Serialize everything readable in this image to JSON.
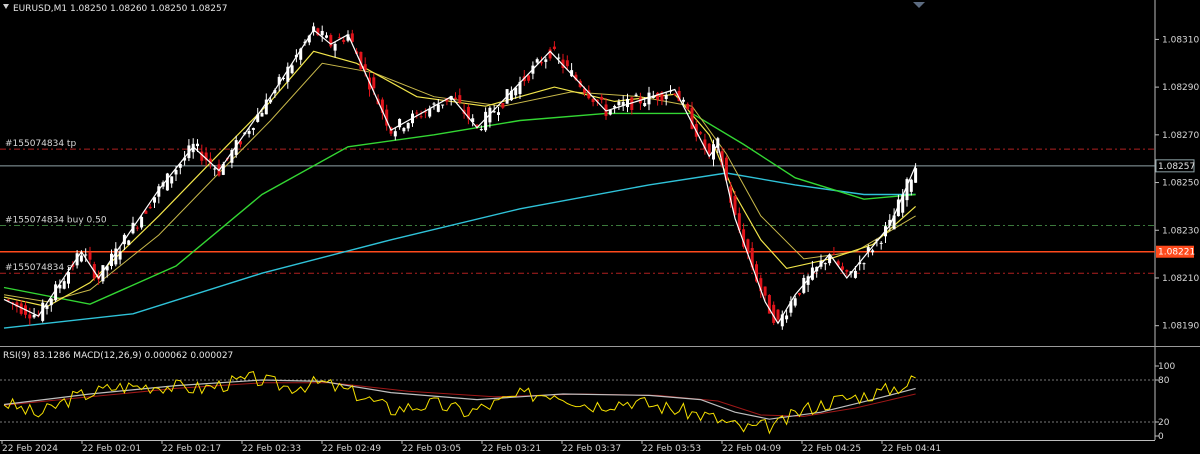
{
  "header": {
    "symbol_line": "EURUSD,M1  1.08250 1.08260 1.08250 1.08257",
    "indicator_line": "RSI(9) 83.1286  MACD(12,26,9) 0.000062 0.000027"
  },
  "colors": {
    "background": "#000000",
    "bull": "#ffffff",
    "bear": "#e0141b",
    "zigzag": "#ffffff",
    "ma_fast": "#f2e54a",
    "ma_fast2": "#c8b84a",
    "ma_mid": "#33d633",
    "ma_slow": "#2fc2d8",
    "rsi": "#f5e000",
    "macd_main": "#bfbfbf",
    "macd_signal": "#a01818",
    "order_line": "#ff4a1c",
    "tp_sl_line": "#b02020",
    "entry_line": "#3c7a3c",
    "bid_line": "#8fa3a8"
  },
  "orders": {
    "tp_label": "#155074834 tp",
    "buy_label": "#155074834 buy 0.50",
    "sl_label": "#155074834 sl",
    "tp_price": 1.08264,
    "buy_price": 1.08232,
    "sl_price": 1.08212,
    "order_price": 1.08221
  },
  "price_axis": {
    "ticks": [
      "1.08310",
      "1.08290",
      "1.08270",
      "1.08250",
      "1.08230",
      "1.08210",
      "1.08190"
    ],
    "current_price": "1.08257",
    "order_price_label": "1.08221"
  },
  "rsi_axis": {
    "ticks": [
      "100",
      "80",
      "20",
      "0"
    ]
  },
  "time_axis": {
    "ticks": [
      "22 Feb 2024",
      "22 Feb 02:01",
      "22 Feb 02:17",
      "22 Feb 02:33",
      "22 Feb 02:49",
      "22 Feb 03:05",
      "22 Feb 03:21",
      "22 Feb 03:37",
      "22 Feb 03:53",
      "22 Feb 04:09",
      "22 Feb 04:25",
      "22 Feb 04:41"
    ]
  },
  "chart_data": {
    "type": "candlestick",
    "symbol": "EURUSD",
    "timeframe": "M1",
    "ylim": [
      1.08184,
      1.08324
    ],
    "price_path": [
      [
        0,
        1.08201
      ],
      [
        8,
        1.08194
      ],
      [
        12,
        1.08205
      ],
      [
        18,
        1.08221
      ],
      [
        22,
        1.0821
      ],
      [
        36,
        1.08247
      ],
      [
        44,
        1.08265
      ],
      [
        50,
        1.08255
      ],
      [
        62,
        1.08286
      ],
      [
        72,
        1.08314
      ],
      [
        76,
        1.08308
      ],
      [
        80,
        1.08312
      ],
      [
        90,
        1.08272
      ],
      [
        104,
        1.08286
      ],
      [
        110,
        1.08273
      ],
      [
        127,
        1.08305
      ],
      [
        140,
        1.0828
      ],
      [
        156,
        1.08289
      ],
      [
        164,
        1.08261
      ],
      [
        166,
        1.08266
      ],
      [
        170,
        1.08235
      ],
      [
        177,
        1.082
      ],
      [
        180,
        1.08191
      ],
      [
        184,
        1.08203
      ],
      [
        192,
        1.0822
      ],
      [
        196,
        1.0821
      ],
      [
        206,
        1.08232
      ],
      [
        212,
        1.08257
      ]
    ],
    "ma_fast": [
      [
        0,
        1.08202
      ],
      [
        10,
        1.08198
      ],
      [
        20,
        1.08208
      ],
      [
        36,
        1.08236
      ],
      [
        50,
        1.08262
      ],
      [
        62,
        1.08284
      ],
      [
        72,
        1.08305
      ],
      [
        82,
        1.083
      ],
      [
        96,
        1.08286
      ],
      [
        112,
        1.08282
      ],
      [
        128,
        1.0829
      ],
      [
        142,
        1.08284
      ],
      [
        156,
        1.08287
      ],
      [
        164,
        1.0827
      ],
      [
        170,
        1.08245
      ],
      [
        176,
        1.08226
      ],
      [
        182,
        1.08214
      ],
      [
        192,
        1.08218
      ],
      [
        202,
        1.08224
      ],
      [
        212,
        1.0824
      ]
    ],
    "ma_fast2": [
      [
        0,
        1.08203
      ],
      [
        10,
        1.082
      ],
      [
        20,
        1.08205
      ],
      [
        36,
        1.08228
      ],
      [
        50,
        1.08254
      ],
      [
        62,
        1.08276
      ],
      [
        74,
        1.083
      ],
      [
        86,
        1.08296
      ],
      [
        100,
        1.08286
      ],
      [
        116,
        1.08282
      ],
      [
        132,
        1.08288
      ],
      [
        148,
        1.08286
      ],
      [
        160,
        1.08282
      ],
      [
        168,
        1.08262
      ],
      [
        176,
        1.08236
      ],
      [
        186,
        1.08218
      ],
      [
        198,
        1.08221
      ],
      [
        212,
        1.08236
      ]
    ],
    "ma_mid": [
      [
        0,
        1.08206
      ],
      [
        20,
        1.08199
      ],
      [
        40,
        1.08215
      ],
      [
        60,
        1.08245
      ],
      [
        80,
        1.08265
      ],
      [
        100,
        1.0827
      ],
      [
        120,
        1.08276
      ],
      [
        140,
        1.08279
      ],
      [
        160,
        1.08279
      ],
      [
        172,
        1.08266
      ],
      [
        184,
        1.08252
      ],
      [
        200,
        1.08243
      ],
      [
        212,
        1.08245
      ]
    ],
    "ma_slow": [
      [
        0,
        1.08189
      ],
      [
        30,
        1.08195
      ],
      [
        60,
        1.08212
      ],
      [
        90,
        1.08226
      ],
      [
        120,
        1.08239
      ],
      [
        150,
        1.08249
      ],
      [
        168,
        1.08254
      ],
      [
        184,
        1.08249
      ],
      [
        200,
        1.08245
      ],
      [
        212,
        1.08245
      ]
    ],
    "rsi": [
      [
        0,
        48
      ],
      [
        8,
        30
      ],
      [
        16,
        55
      ],
      [
        26,
        70
      ],
      [
        36,
        72
      ],
      [
        46,
        68
      ],
      [
        58,
        82
      ],
      [
        66,
        70
      ],
      [
        74,
        76
      ],
      [
        82,
        60
      ],
      [
        90,
        38
      ],
      [
        100,
        46
      ],
      [
        108,
        34
      ],
      [
        120,
        58
      ],
      [
        128,
        62
      ],
      [
        136,
        44
      ],
      [
        146,
        50
      ],
      [
        156,
        38
      ],
      [
        164,
        28
      ],
      [
        172,
        10
      ],
      [
        180,
        16
      ],
      [
        186,
        38
      ],
      [
        194,
        52
      ],
      [
        202,
        60
      ],
      [
        210,
        74
      ],
      [
        212,
        83
      ]
    ],
    "macd_main": [
      [
        0,
        45
      ],
      [
        20,
        60
      ],
      [
        40,
        72
      ],
      [
        60,
        80
      ],
      [
        74,
        78
      ],
      [
        90,
        62
      ],
      [
        110,
        52
      ],
      [
        130,
        60
      ],
      [
        150,
        58
      ],
      [
        162,
        52
      ],
      [
        170,
        34
      ],
      [
        178,
        24
      ],
      [
        190,
        34
      ],
      [
        202,
        52
      ],
      [
        212,
        68
      ]
    ],
    "macd_signal": [
      [
        0,
        44
      ],
      [
        20,
        56
      ],
      [
        40,
        68
      ],
      [
        60,
        76
      ],
      [
        76,
        76
      ],
      [
        94,
        64
      ],
      [
        114,
        56
      ],
      [
        134,
        60
      ],
      [
        152,
        58
      ],
      [
        166,
        50
      ],
      [
        176,
        30
      ],
      [
        186,
        28
      ],
      [
        198,
        40
      ],
      [
        212,
        60
      ]
    ],
    "rsi_levels": [
      80,
      20
    ]
  }
}
